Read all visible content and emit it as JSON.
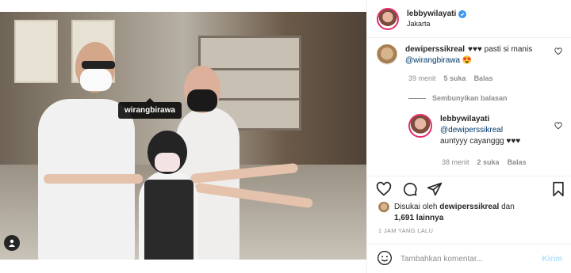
{
  "post": {
    "photo_tag": "wirangbirawa"
  },
  "header": {
    "username": "lebbywilayati",
    "location": "Jakarta"
  },
  "comments": [
    {
      "username": "dewiperssikreal",
      "text_prefix": "♥♥♥ pasti si manis ",
      "mention": "@wirangbirawa",
      "text_suffix": " 😍",
      "time": "39 menit",
      "likes": "5 suka",
      "reply_label": "Balas"
    }
  ],
  "replies_toggle": "Sembunyikan balasan",
  "reply": {
    "username": "lebbywilayati",
    "mention": "@dewiperssikreal",
    "text": "auntyyy cayanggg ♥♥♥",
    "time": "38 menit",
    "likes": "2 suka",
    "reply_label": "Balas"
  },
  "likes_summary": {
    "prefix": "Disukai oleh ",
    "user": "dewiperssikreal",
    "middle": " dan",
    "count": "1,691 lainnya"
  },
  "timestamp": "1 JAM YANG LALU",
  "comment_box": {
    "placeholder": "Tambahkan komentar...",
    "post_label": "Kirim"
  },
  "colors": {
    "verified": "#3897f0",
    "link": "#00376b",
    "post_disabled": "#b2dffc"
  },
  "icons": [
    "heart-icon",
    "comment-icon",
    "share-icon",
    "bookmark-icon",
    "emoji-icon",
    "user-tag-icon",
    "verified-badge-icon"
  ]
}
